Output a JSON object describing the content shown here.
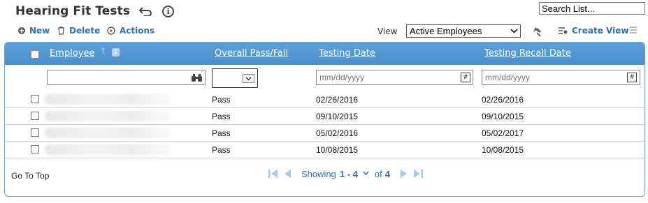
{
  "header": {
    "title": "Hearing Fit Tests"
  },
  "search": {
    "placeholder": "Search List..."
  },
  "toolbar": {
    "new_label": "New",
    "delete_label": "Delete",
    "actions_label": "Actions",
    "view_label": "View",
    "view_selected": "Active Employees",
    "create_view_label": "Create View"
  },
  "table": {
    "columns": [
      "Employee",
      "Overall Pass/Fail",
      "Testing Date",
      "Testing Recall Date"
    ],
    "sort_badge": "1",
    "filters": {
      "testing_date_placeholder": "mm/dd/yyyy",
      "recall_date_placeholder": "mm/dd/yyyy"
    },
    "rows": [
      {
        "result": "Pass",
        "testing_date": "02/26/2016",
        "recall_date": "02/26/2016"
      },
      {
        "result": "Pass",
        "testing_date": "09/10/2015",
        "recall_date": "09/10/2015"
      },
      {
        "result": "Pass",
        "testing_date": "05/02/2016",
        "recall_date": "05/02/2017"
      },
      {
        "result": "Pass",
        "testing_date": "10/08/2015",
        "recall_date": "10/08/2015"
      }
    ]
  },
  "footer": {
    "go_to_top": "Go To Top",
    "showing_label": "Showing",
    "range": "1 - 4",
    "of_label": "of",
    "total": "4"
  },
  "colors": {
    "accent": "#2f6fb5",
    "header_bg": "#5ea0d8"
  }
}
